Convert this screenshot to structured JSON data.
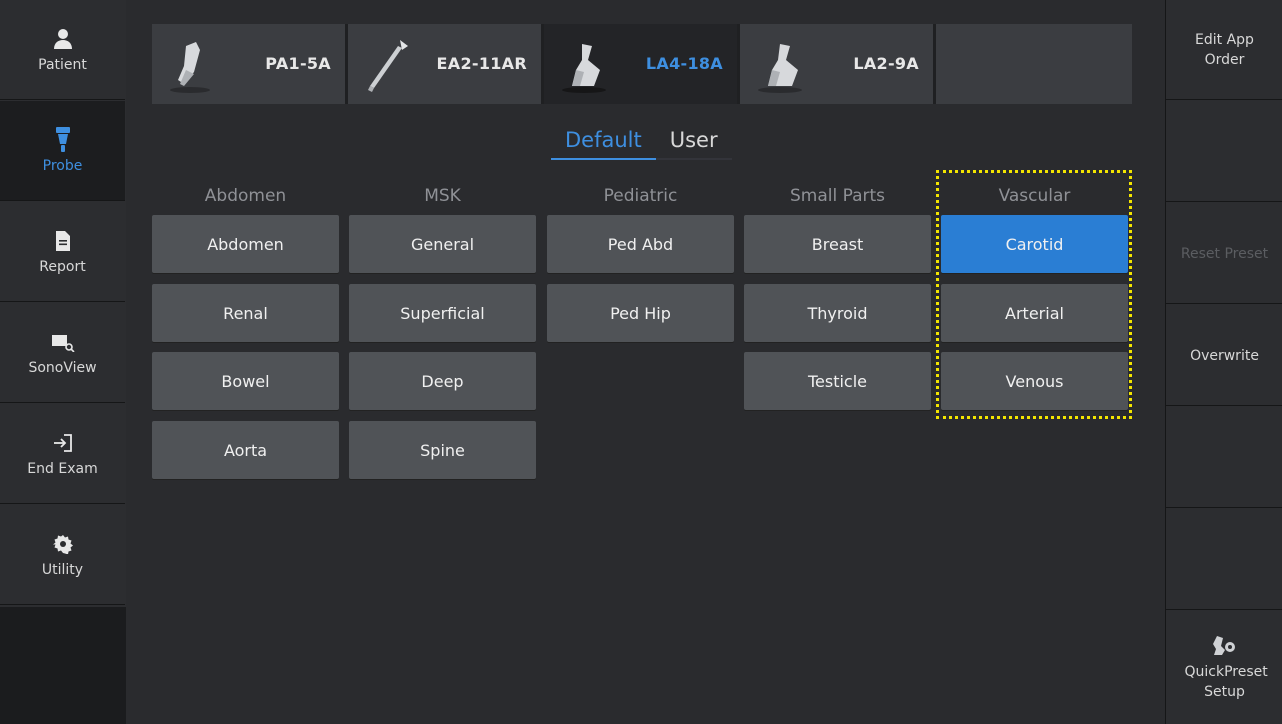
{
  "left_nav": {
    "items": [
      {
        "label": "Patient",
        "icon": "person-icon",
        "active": false
      },
      {
        "label": "Probe",
        "icon": "probe-icon",
        "active": true
      },
      {
        "label": "Report",
        "icon": "document-icon",
        "active": false
      },
      {
        "label": "SonoView",
        "icon": "image-search-icon",
        "active": false
      },
      {
        "label": "End Exam",
        "icon": "exit-icon",
        "active": false
      },
      {
        "label": "Utility",
        "icon": "gear-icon",
        "active": false
      }
    ]
  },
  "probes": [
    {
      "name": "PA1-5A",
      "active": false
    },
    {
      "name": "EA2-11AR",
      "active": false
    },
    {
      "name": "LA4-18A",
      "active": true
    },
    {
      "name": "LA2-9A",
      "active": false
    }
  ],
  "preset_tabs": [
    {
      "label": "Default",
      "active": true
    },
    {
      "label": "User",
      "active": false
    }
  ],
  "categories": [
    {
      "name": "Abdomen",
      "presets": [
        "Abdomen",
        "Renal",
        "Bowel",
        "Aorta"
      ]
    },
    {
      "name": "MSK",
      "presets": [
        "General",
        "Superficial",
        "Deep",
        "Spine"
      ]
    },
    {
      "name": "Pediatric",
      "presets": [
        "Ped Abd",
        "Ped Hip"
      ]
    },
    {
      "name": "Small Parts",
      "presets": [
        "Breast",
        "Thyroid",
        "Testicle"
      ]
    },
    {
      "name": "Vascular",
      "presets": [
        "Carotid",
        "Arterial",
        "Venous"
      ]
    }
  ],
  "selected_preset": "Carotid",
  "right_panel": {
    "edit_app_order": "Edit App Order",
    "reset_preset": "Reset Preset",
    "overwrite": "Overwrite",
    "quickpreset_setup": "QuickPreset Setup"
  },
  "colors": {
    "accent": "#3e8fe0",
    "selected_button": "#2a7ed4",
    "highlight": "#f3e500"
  }
}
